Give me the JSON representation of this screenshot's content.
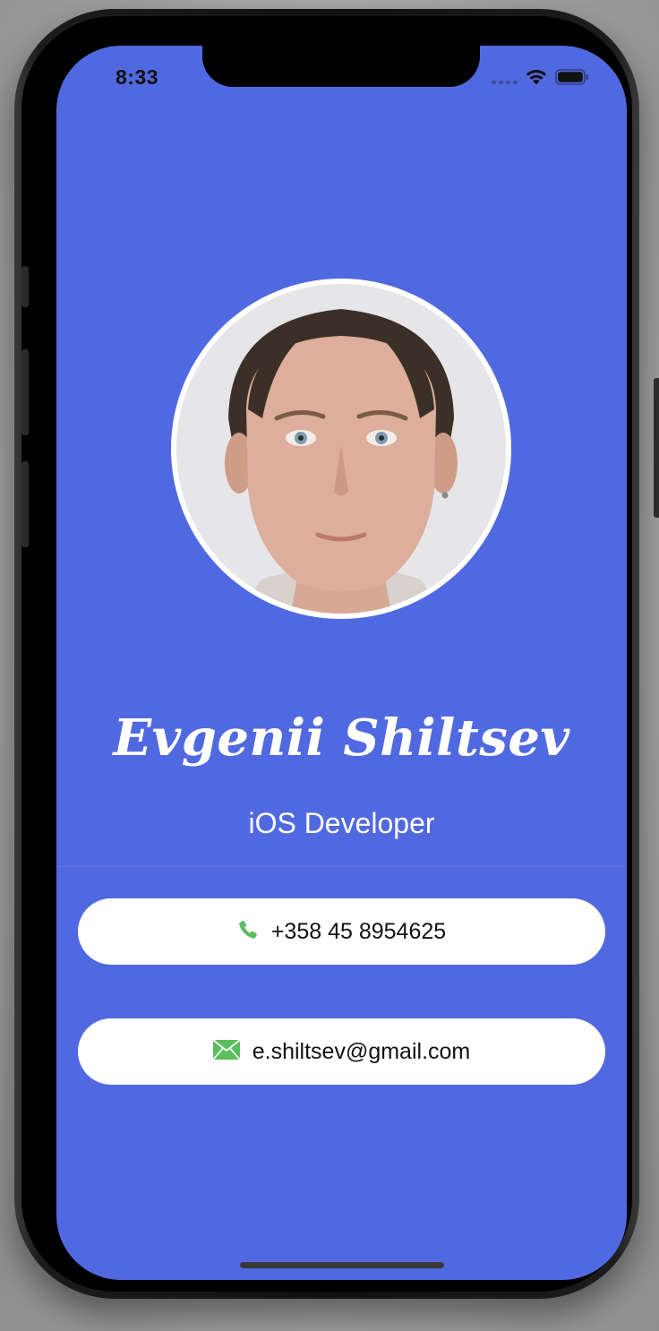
{
  "status_bar": {
    "time": "8:33",
    "icons": [
      "cellular-icon",
      "wifi-icon",
      "battery-icon"
    ]
  },
  "profile": {
    "photo_alt": "profile-photo",
    "name": "Evgenii Shiltsev",
    "title": "iOS Developer"
  },
  "contacts": {
    "phone": {
      "icon": "phone-icon",
      "value": "+358 45 8954625"
    },
    "email": {
      "icon": "envelope-icon",
      "value": "e.shiltsev@gmail.com"
    }
  },
  "colors": {
    "background": "#5169e0",
    "card": "#ffffff",
    "icon_green": "#5cbd5c",
    "text_dark": "#111111"
  }
}
